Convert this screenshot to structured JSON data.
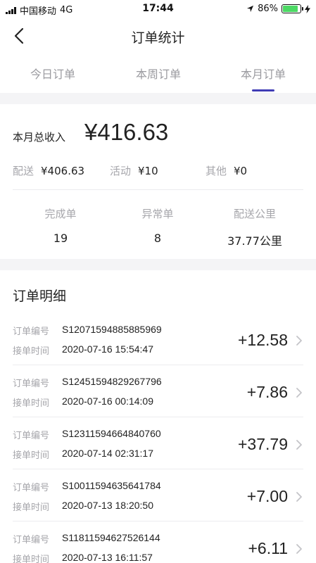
{
  "status_bar": {
    "carrier": "中国移动",
    "network": "4G",
    "time": "17:44",
    "battery_text": "86%",
    "battery_level": 0.86,
    "battery_color": "#4cd964"
  },
  "nav": {
    "title": "订单统计",
    "back_icon": "chevron-left-icon"
  },
  "tabs": [
    {
      "label": "今日订单",
      "active": false
    },
    {
      "label": "本周订单",
      "active": false
    },
    {
      "label": "本月订单",
      "active": true
    }
  ],
  "accent_color": "#3f3cb5",
  "summary": {
    "income_label": "本月总收入",
    "income_value": "¥416.63",
    "breakdown": [
      {
        "label": "配送",
        "value": "¥406.63"
      },
      {
        "label": "活动",
        "value": "¥10"
      },
      {
        "label": "其他",
        "value": "¥0"
      }
    ],
    "stats": [
      {
        "label": "完成单",
        "value": "19"
      },
      {
        "label": "异常单",
        "value": "8"
      },
      {
        "label": "配送公里",
        "value": "37.77公里"
      }
    ]
  },
  "orders_section": {
    "title": "订单明细",
    "order_no_label": "订单编号",
    "accept_time_label": "接单时间",
    "orders": [
      {
        "order_no": "S12071594885885969",
        "time": "2020-07-16 15:54:47",
        "amount": "+12.58"
      },
      {
        "order_no": "S12451594829267796",
        "time": "2020-07-16 00:14:09",
        "amount": "+7.86"
      },
      {
        "order_no": "S12311594664840760",
        "time": "2020-07-14 02:31:17",
        "amount": "+37.79"
      },
      {
        "order_no": "S10011594635641784",
        "time": "2020-07-13 18:20:50",
        "amount": "+7.00"
      },
      {
        "order_no": "S11811594627526144",
        "time": "2020-07-13 16:11:57",
        "amount": "+6.11"
      }
    ]
  }
}
